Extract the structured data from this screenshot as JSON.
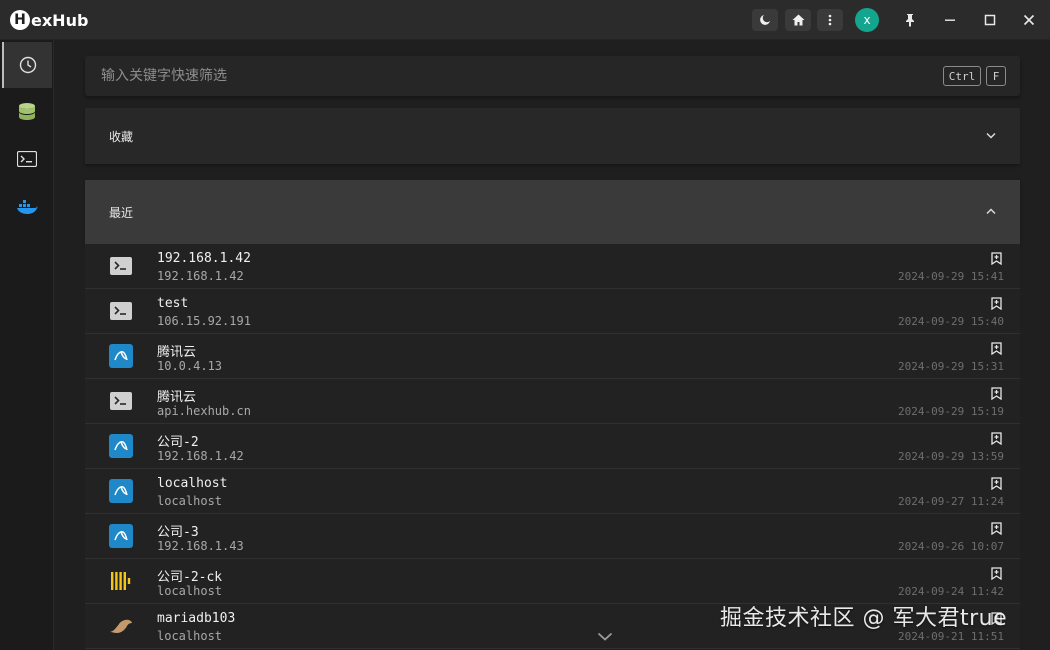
{
  "app": {
    "logo_letter": "H",
    "logo_rest": "exHub"
  },
  "titlebar": {
    "theme_icon": "moon-icon",
    "home_icon": "home-icon",
    "more_icon": "more-vertical-icon",
    "avatar_letter": "x",
    "pin_icon": "pin-icon",
    "min_icon": "minimize-icon",
    "max_icon": "maximize-icon",
    "close_icon": "close-icon",
    "avatar_color": "#14a58e"
  },
  "sidebar": {
    "items": [
      {
        "name": "recent",
        "icon": "clock-icon",
        "active": true
      },
      {
        "name": "database",
        "icon": "database-icon",
        "active": false
      },
      {
        "name": "terminal",
        "icon": "terminal-icon",
        "active": false
      },
      {
        "name": "docker",
        "icon": "docker-icon",
        "active": false
      }
    ]
  },
  "search": {
    "placeholder": "输入关键字快速筛选",
    "shortcut": [
      "Ctrl",
      "F"
    ]
  },
  "favorites": {
    "label": "收藏",
    "expanded": false
  },
  "recent": {
    "label": "最近",
    "expanded": true,
    "items": [
      {
        "name": "192.168.1.42",
        "host": "192.168.1.42",
        "time": "2024-09-29 15:41",
        "type": "ssh"
      },
      {
        "name": "test",
        "host": "106.15.92.191",
        "time": "2024-09-29 15:40",
        "type": "ssh"
      },
      {
        "name": "腾讯云",
        "host": "10.0.4.13",
        "time": "2024-09-29 15:31",
        "type": "mysql"
      },
      {
        "name": "腾讯云",
        "host": "api.hexhub.cn",
        "time": "2024-09-29 15:19",
        "type": "ssh"
      },
      {
        "name": "公司-2",
        "host": "192.168.1.42",
        "time": "2024-09-29 13:59",
        "type": "mysql"
      },
      {
        "name": "localhost",
        "host": "localhost",
        "time": "2024-09-27 11:24",
        "type": "mysql"
      },
      {
        "name": "公司-3",
        "host": "192.168.1.43",
        "time": "2024-09-26 10:07",
        "type": "mysql"
      },
      {
        "name": "公司-2-ck",
        "host": "localhost",
        "time": "2024-09-24 11:42",
        "type": "clickhouse"
      },
      {
        "name": "mariadb103",
        "host": "localhost",
        "time": "2024-09-21 11:51",
        "type": "mariadb"
      }
    ]
  },
  "watermark": "掘金技术社区 @ 军大君true",
  "colors": {
    "mysql": "#1e88c8",
    "clickhouse": "#f5c518",
    "mariadb": "#c49a6c",
    "terminal_bg": "#d0d0d0"
  }
}
